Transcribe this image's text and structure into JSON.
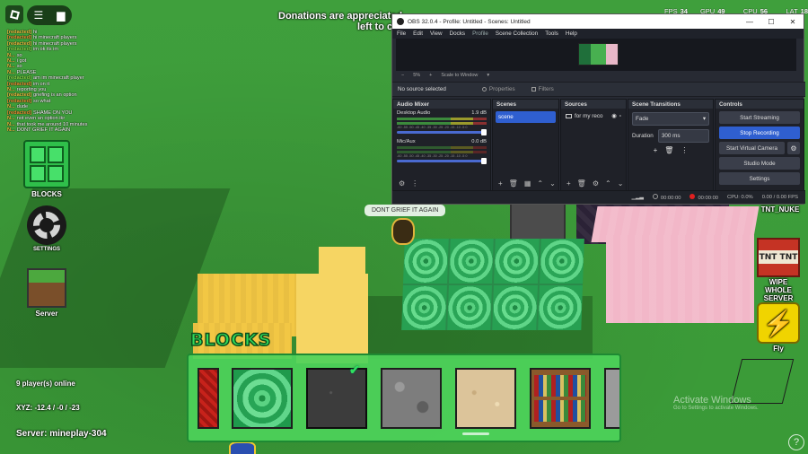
{
  "window": {
    "obs_title": "OBS 32.0.4 - Profile: Untitled - Scenes: Untitled",
    "controls": [
      "—",
      "☐",
      "✕"
    ]
  },
  "banner": {
    "line1": "Donations are appreciated",
    "line2": "left to c"
  },
  "stats": {
    "fps_label": "FPS",
    "fps_value": "34",
    "gpu_label": "GPU",
    "gpu_value": "49 %",
    "cpu_label": "CPU",
    "cpu_value": "56 %",
    "lat_label": "LAT",
    "lat_value": "18"
  },
  "chat": [
    {
      "who": "[redacted]",
      "msg": "hi",
      "color": "#f2c744"
    },
    {
      "who": "[redacted]",
      "msg": "hi minecraft players",
      "color": "#f29a38"
    },
    {
      "who": "[redacted]",
      "msg": "hi minecraft players",
      "color": "#f2c744"
    },
    {
      "who": "[redacted]",
      "msg": "im ok its im",
      "color": "#8ae04a"
    },
    {
      "who": "N...",
      "msg": "so",
      "color": "#f2c744"
    },
    {
      "who": "N...",
      "msg": "i got",
      "color": "#f2c744"
    },
    {
      "who": "N...",
      "msg": "so",
      "color": "#f2c744"
    },
    {
      "who": "N...",
      "msg": "PLEASE",
      "color": "#f2c744"
    },
    {
      "who": "[redacted]",
      "msg": "am im minecraft player",
      "color": "#8ae04a"
    },
    {
      "who": "[redacted]",
      "msg": "im on it",
      "color": "#f29a38"
    },
    {
      "who": "N...",
      "msg": "reporting you",
      "color": "#f2c744"
    },
    {
      "who": "[redacted]",
      "msg": "griefing is an option",
      "color": "#f2c744"
    },
    {
      "who": "[redacted]",
      "msg": "so what",
      "color": "#f29a38"
    },
    {
      "who": "N...",
      "msg": "dude",
      "color": "#f2c744"
    },
    {
      "who": "[redacted]",
      "msg": "SHAME ON YOU",
      "color": "#f29a38"
    },
    {
      "who": "N...",
      "msg": "not even an option ikr",
      "color": "#f2c744"
    },
    {
      "who": "N...",
      "msg": "that took me around 10 minutes",
      "color": "#f2c744"
    },
    {
      "who": "N...",
      "msg": "DONT GRIEF IT AGAIN",
      "color": "#f2c744"
    }
  ],
  "side_menu": {
    "blocks": "BLOCKS",
    "settings": "SETTINGS",
    "server": "Server"
  },
  "right_menu": {
    "tnt_nuke": "TNT_NUKE",
    "wipe": "WIPE WHOLE SERVER",
    "fly": "Fly",
    "tnt_text": "TNT TNT"
  },
  "bubble": "DONT GRIEF IT AGAIN",
  "hotbar": {
    "title": "BLOCKS"
  },
  "info": {
    "players": "9 player(s) online",
    "xyz": "XYZ: -12.4 / -0 / -23",
    "server": "Server: mineplay-304"
  },
  "watermark": {
    "title": "Activate Windows",
    "sub": "Go to Settings to activate Windows."
  },
  "obs": {
    "menu": [
      "File",
      "Edit",
      "View",
      "Docks",
      "Profile",
      "Scene Collection",
      "Tools",
      "Help"
    ],
    "zoom": "5%",
    "scale_mode": "Scale to Window",
    "no_source": "No source selected",
    "properties": "Properties",
    "filters": "Filters",
    "docks": {
      "audio_mixer": "Audio Mixer",
      "scenes": "Scenes",
      "sources": "Sources",
      "scene_transitions": "Scene Transitions",
      "controls": "Controls"
    },
    "mixer": [
      {
        "name": "Desktop Audio",
        "db": "1.9 dB"
      },
      {
        "name": "Mic/Aux",
        "db": "0.0 dB"
      }
    ],
    "ticks": "-60 -55 -50 -45 -40 -35 -30 -25 -20 -15 -10 -5 0",
    "scene_item": "scene",
    "source_item": "for my reco",
    "transition": "Fade",
    "duration_label": "Duration",
    "duration_value": "300 ms",
    "controls": {
      "start_streaming": "Start Streaming",
      "stop_recording": "Stop Recording",
      "start_virtual_camera": "Start Virtual Camera",
      "studio_mode": "Studio Mode",
      "settings": "Settings"
    },
    "status": {
      "live_time": "00:00:00",
      "rec_time": "00:00:00",
      "cpu": "CPU: 0.0%",
      "fps": "0.00 / 0.00 FPS"
    }
  },
  "colors": {
    "accent": "#2f5fd0",
    "hotbar": "#4dd25a"
  }
}
